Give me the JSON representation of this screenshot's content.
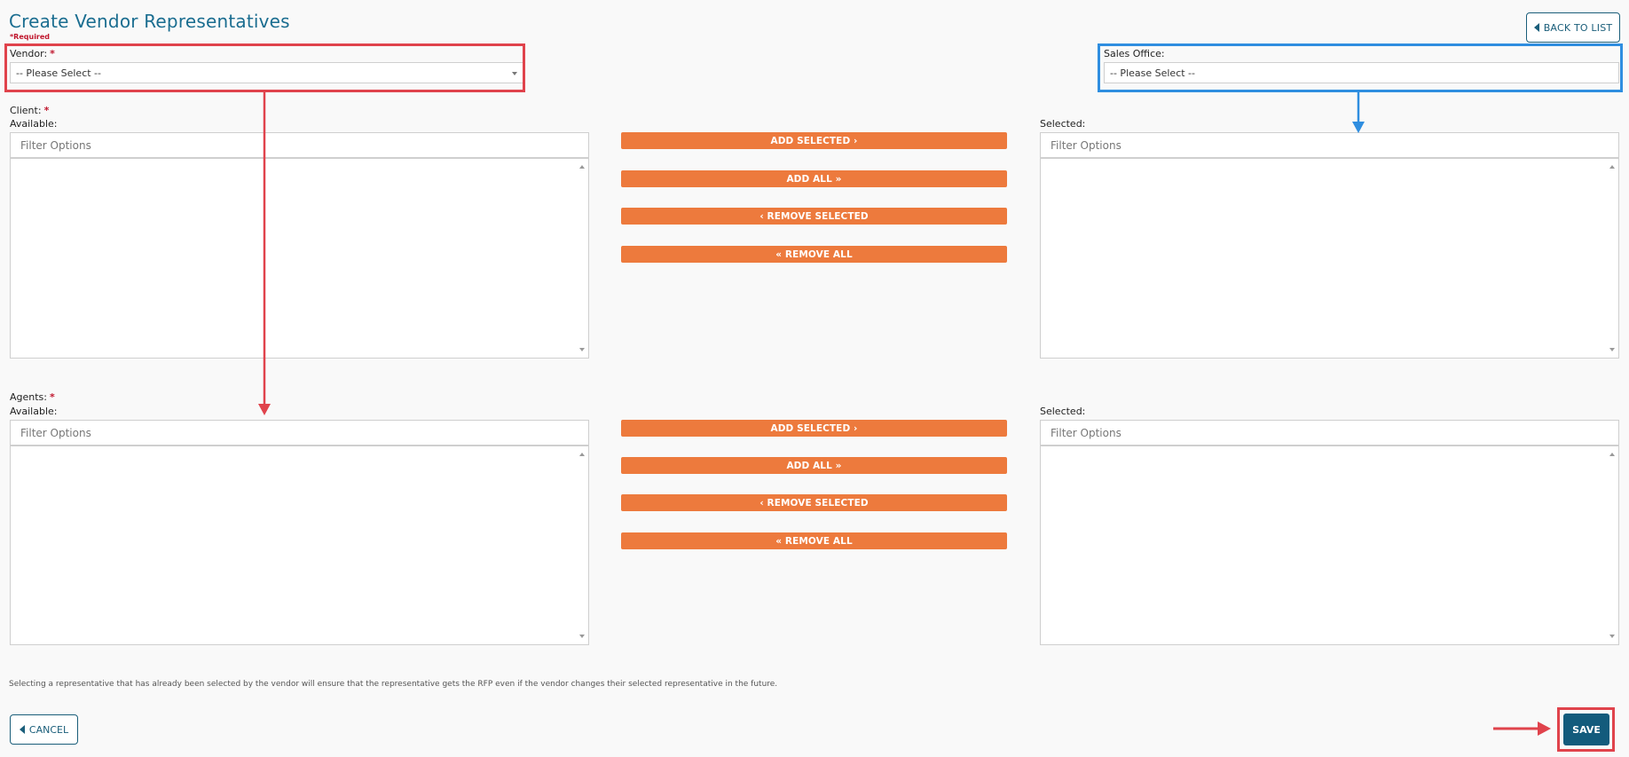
{
  "page": {
    "title": "Create Vendor Representatives",
    "required_note": "*Required",
    "back_label": "BACK TO LIST",
    "footer_note": "Selecting a representative that has already been selected by the vendor will ensure that the representative gets the RFP even if the vendor changes their selected representative in the future.",
    "cancel_label": "CANCEL",
    "save_label": "SAVE"
  },
  "vendor": {
    "label": "Vendor:",
    "value": "-- Please Select --"
  },
  "sales_office": {
    "label": "Sales Office:",
    "value": "-- Please Select --"
  },
  "client": {
    "label": "Client:",
    "available_label": "Available:",
    "selected_label": "Selected:",
    "filter_placeholder": "Filter Options"
  },
  "agents": {
    "label": "Agents:",
    "available_label": "Available:",
    "selected_label": "Selected:",
    "filter_placeholder": "Filter Options"
  },
  "transfer_buttons": {
    "add_selected": "ADD SELECTED",
    "add_all": "ADD ALL",
    "remove_selected": "REMOVE SELECTED",
    "remove_all": "REMOVE ALL"
  },
  "colors": {
    "title": "#1a6d90",
    "required": "#c0172e",
    "accent_orange": "#ed7a3d",
    "primary_dark": "#135b7c",
    "annotation_red": "#e0434c",
    "annotation_blue": "#2f8ee0"
  },
  "icons": {
    "back": "triangle-left-icon",
    "add": "chevron-right-icon",
    "add_all": "double-chevron-right-icon",
    "remove": "chevron-left-icon",
    "remove_all": "double-chevron-left-icon",
    "dropdown": "caret-down-icon"
  }
}
